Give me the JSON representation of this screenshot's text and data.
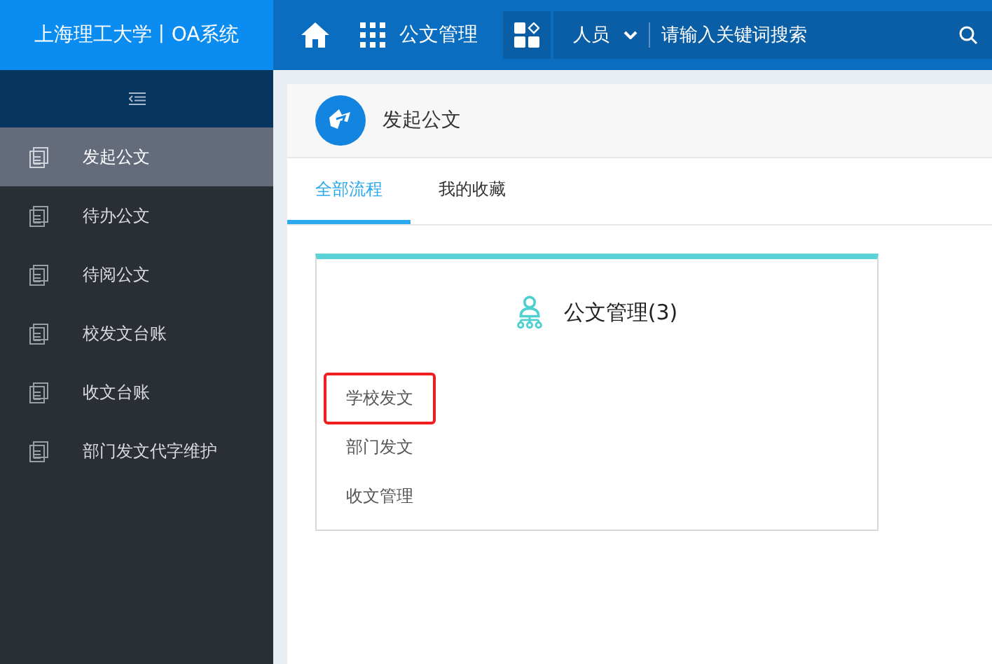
{
  "topbar": {
    "brand": "上海理工大学丨OA系统",
    "module": "公文管理",
    "search": {
      "scope": "人员",
      "placeholder": "请输入关键词搜索"
    }
  },
  "sidebar": {
    "items": [
      {
        "label": "发起公文",
        "selected": true
      },
      {
        "label": "待办公文",
        "selected": false
      },
      {
        "label": "待阅公文",
        "selected": false
      },
      {
        "label": "校发文台账",
        "selected": false
      },
      {
        "label": "收文台账",
        "selected": false
      },
      {
        "label": "部门发文代字维护",
        "selected": false
      }
    ]
  },
  "page": {
    "title": "发起公文",
    "tabs": [
      {
        "label": "全部流程",
        "selected": true
      },
      {
        "label": "我的收藏",
        "selected": false
      }
    ],
    "card": {
      "title": "公文管理(3)",
      "items": [
        {
          "label": "学校发文",
          "highlighted": true
        },
        {
          "label": "部门发文",
          "highlighted": false
        },
        {
          "label": "收文管理",
          "highlighted": false
        }
      ]
    }
  }
}
